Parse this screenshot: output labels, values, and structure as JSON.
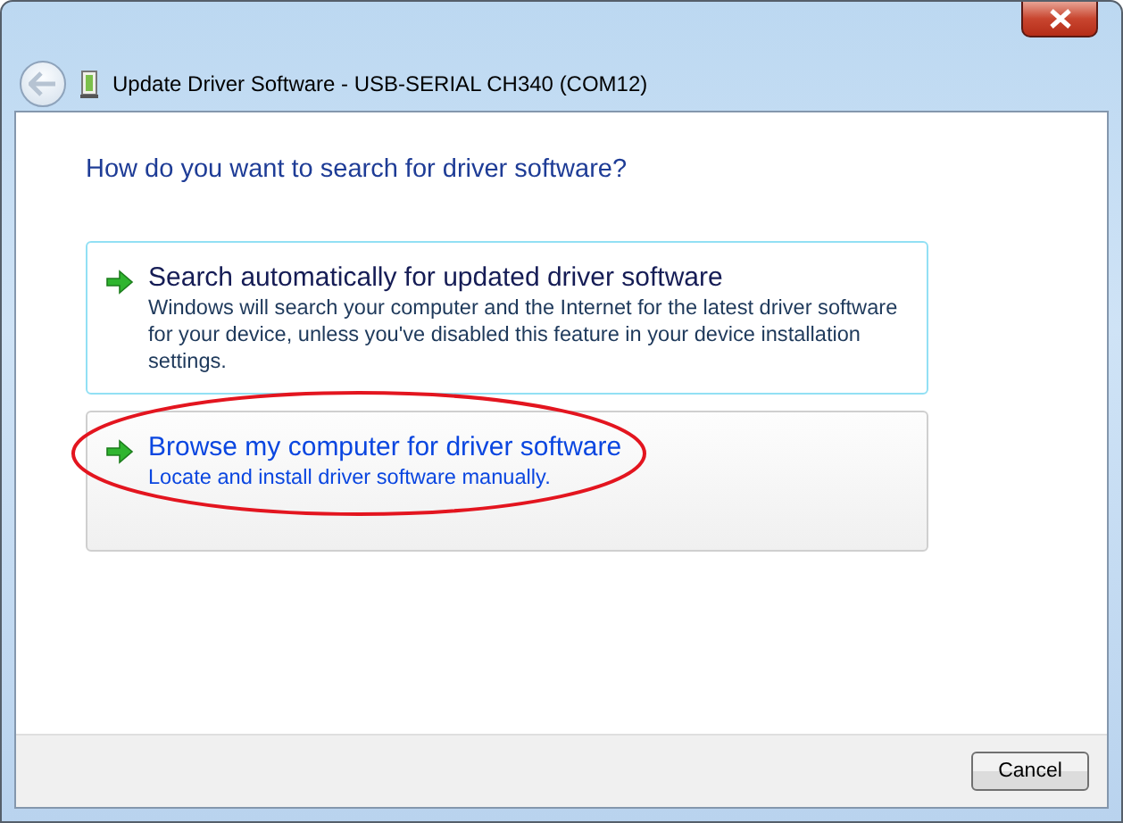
{
  "window": {
    "title": "Update Driver Software - USB-SERIAL CH340 (COM12)"
  },
  "heading": "How do you want to search for driver software?",
  "options": [
    {
      "title": "Search automatically for updated driver software",
      "description": "Windows will search your computer and the Internet for the latest driver software for your device, unless you've disabled this feature in your device installation settings.",
      "focused": true,
      "hovered": false,
      "circled": false
    },
    {
      "title": "Browse my computer for driver software",
      "description": "Locate and install driver software manually.",
      "focused": false,
      "hovered": true,
      "circled": true
    }
  ],
  "buttons": [
    "Cancel"
  ]
}
